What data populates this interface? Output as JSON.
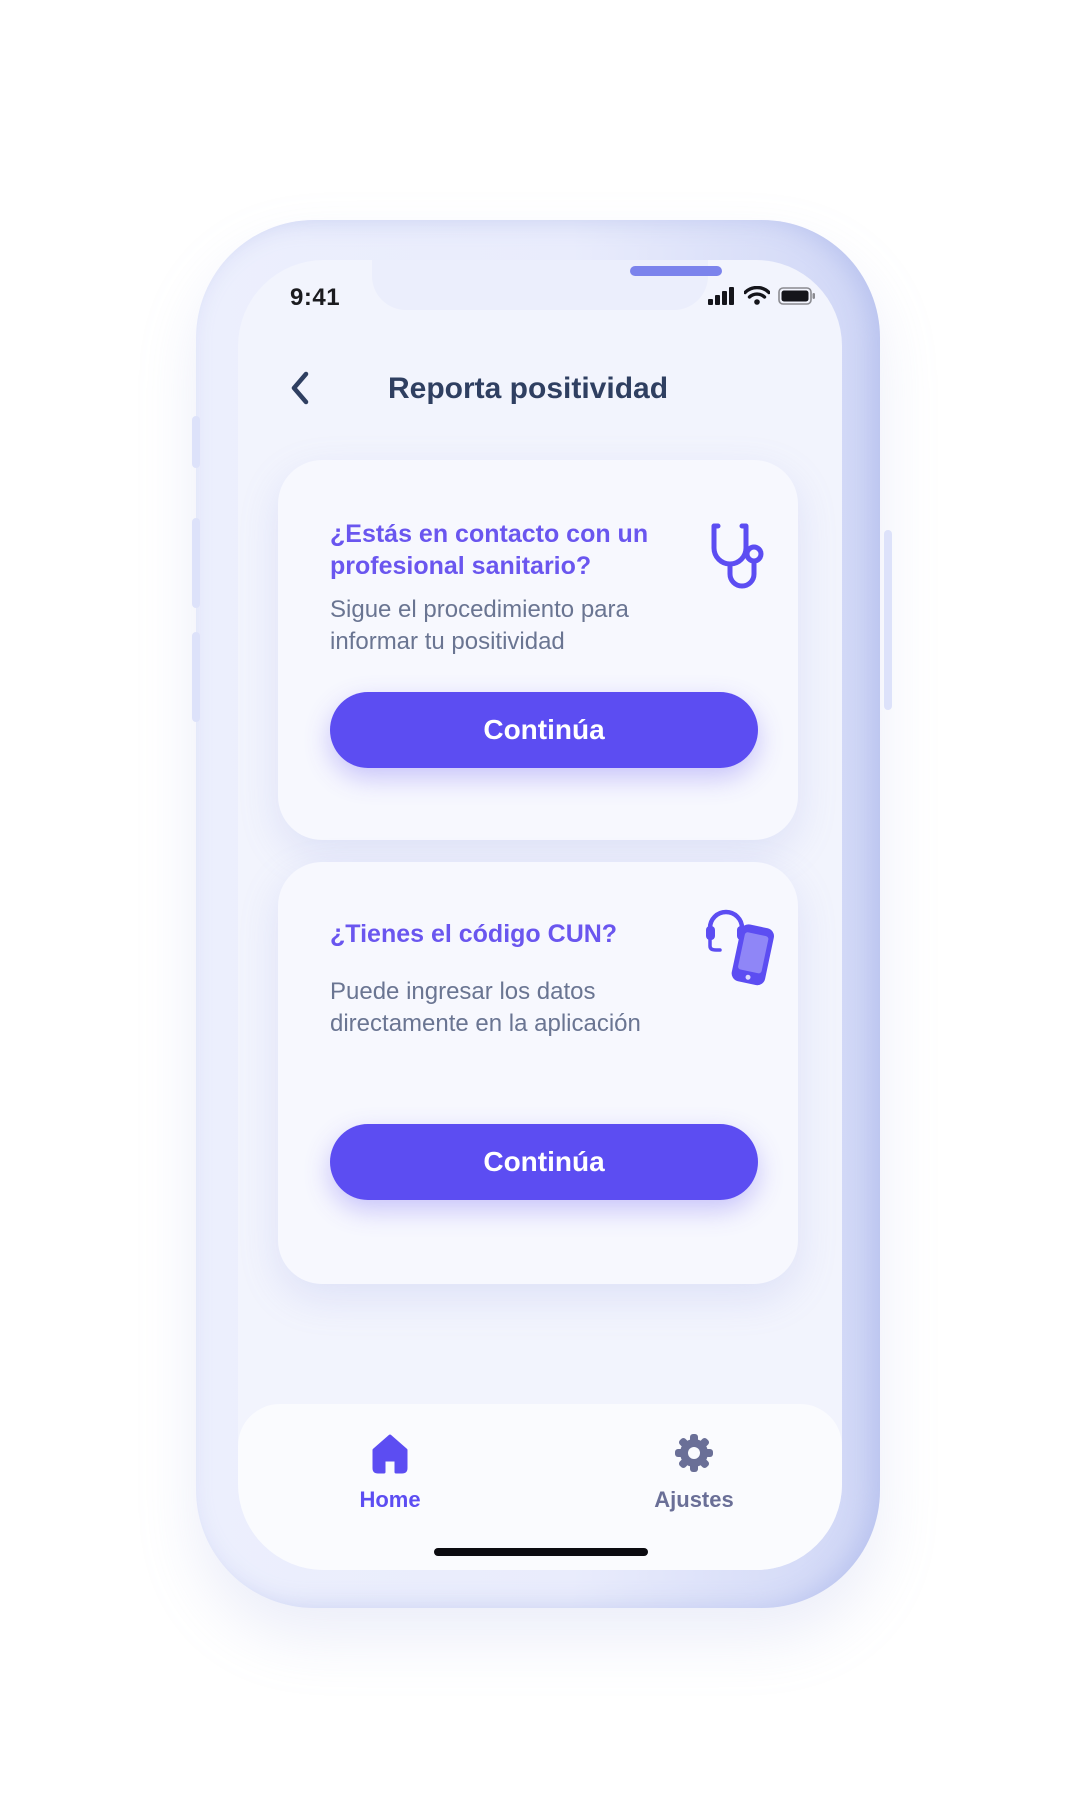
{
  "status_bar": {
    "time": "9:41",
    "icons": [
      "signal-icon",
      "wifi-icon",
      "battery-icon"
    ]
  },
  "header": {
    "back_icon": "chevron-left-icon",
    "title": "Reporta positividad"
  },
  "cards": [
    {
      "title": "¿Estás en contacto con un profesional sanitario?",
      "description": "Sigue el procedimiento para informar tu positividad",
      "icon": "stethoscope-icon",
      "button_label": "Continúa"
    },
    {
      "title": "¿Tienes el código CUN?",
      "description": "Puede ingresar los datos directamente en la aplicación",
      "icon": "phone-support-icon",
      "button_label": "Continúa"
    }
  ],
  "tabbar": {
    "home": {
      "label": "Home",
      "icon": "home-icon",
      "active": true
    },
    "settings": {
      "label": "Ajustes",
      "icon": "gear-icon",
      "active": false
    }
  },
  "colors": {
    "accent": "#5c4df2",
    "title_text": "#2f3f61",
    "card_title": "#6a56ef",
    "body_text": "#6a7592",
    "inactive_tab": "#6a6f97",
    "background": "#f2f4fd"
  }
}
